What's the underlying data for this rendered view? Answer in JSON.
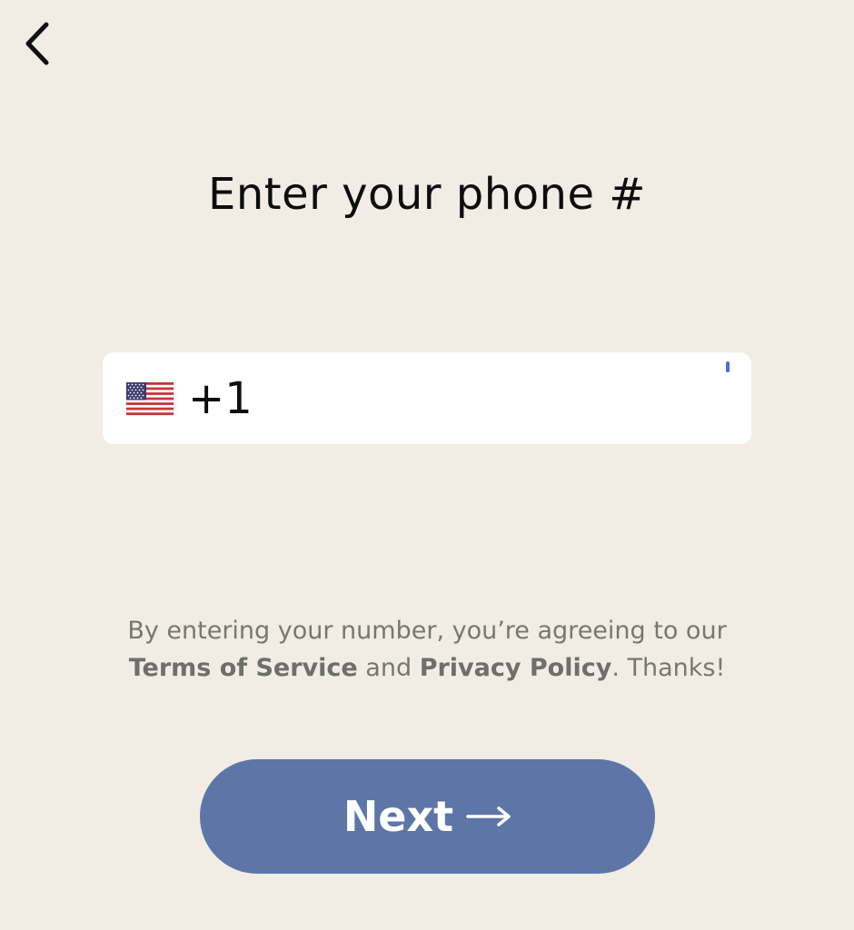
{
  "header": {
    "back_icon": "chevron-left-icon"
  },
  "page": {
    "title": "Enter your phone #"
  },
  "phone": {
    "flag_icon": "us-flag-icon",
    "country_code": "+1",
    "value": ""
  },
  "disclaimer": {
    "prefix": "By entering your number, you’re agreeing to our",
    "terms_label": "Terms of Service",
    "and_text": " and ",
    "privacy_label": "Privacy Policy",
    "suffix": ". Thanks!"
  },
  "footer": {
    "next_label": "Next",
    "next_icon": "arrow-right-icon"
  },
  "colors": {
    "background": "#f1ede4",
    "field": "#ffffff",
    "button": "#5e75a8",
    "caret": "#4a6cd4"
  }
}
